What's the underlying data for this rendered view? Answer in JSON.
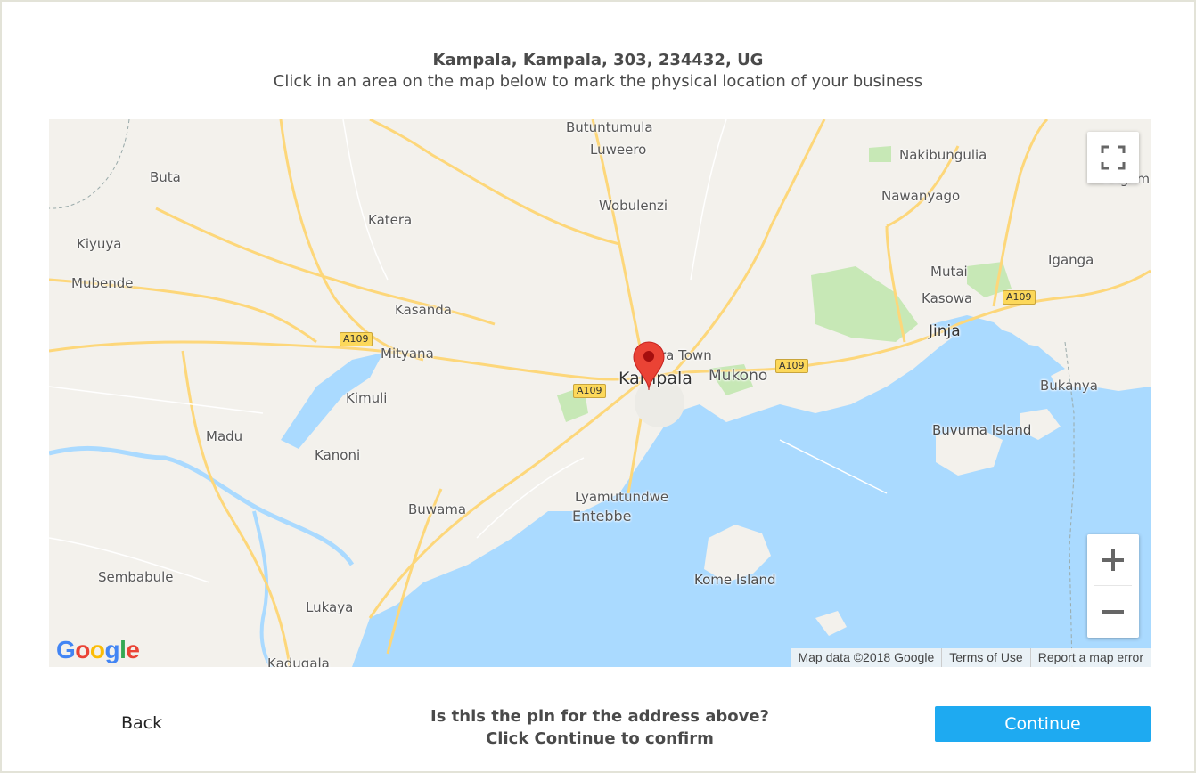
{
  "header": {
    "address": "Kampala, Kampala, 303, 234432, UG",
    "instruction": "Click in an area on the map below to mark the physical location of your business"
  },
  "map": {
    "places": {
      "butuntumula": "Butuntumula",
      "luweero": "Luweero",
      "nakibungulia": "Nakibungulia",
      "buta": "Buta",
      "nawanyago": "Nawanyago",
      "bugem": "Bugem",
      "katera": "Katera",
      "wobulenzi": "Wobulenzi",
      "kiyuya": "Kiyuya",
      "iganga": "Iganga",
      "mutai": "Mutai",
      "mubende": "Mubende",
      "kasowa": "Kasowa",
      "kasanda": "Kasanda",
      "jinja": "Jinja",
      "mityana": "Mityana",
      "kira_town": "Kira Town",
      "kampala": "Kampala",
      "mukono": "Mukono",
      "kimuli": "Kimuli",
      "bukanya": "Bukanya",
      "madu": "Madu",
      "bunvuma_island": "Buvuma Island",
      "kanoni": "Kanoni",
      "lyamutundwe": "Lyamutundwe",
      "buwama": "Buwama",
      "entebbe": "Entebbe",
      "kome_island": "Kome Island",
      "sembabule": "Sembabule",
      "lukaya": "Lukaya",
      "kadugala": "Kadugala"
    },
    "road_shields": {
      "a109_1": "A109",
      "a109_2": "A109",
      "a109_3": "A109",
      "a109_4": "A109"
    },
    "controls": {
      "zoom_in": "+",
      "zoom_out": "−"
    },
    "logo": {
      "G": "G",
      "o1": "o",
      "o2": "o",
      "g": "g",
      "l": "l",
      "e": "e"
    },
    "attribution": {
      "map_data": "Map data ©2018 Google",
      "terms": "Terms of Use",
      "report": "Report a map error"
    },
    "colors": {
      "land": "#f3f1ec",
      "water": "#aadaff",
      "road": "#fdd77a",
      "park": "#c7e8b6",
      "pin": "#ea4335"
    }
  },
  "footer": {
    "back_label": "Back",
    "confirm_line1": "Is this the pin for the address above?",
    "confirm_line2": "Click Continue to confirm",
    "continue_label": "Continue",
    "button_color": "#1eaaf1"
  }
}
